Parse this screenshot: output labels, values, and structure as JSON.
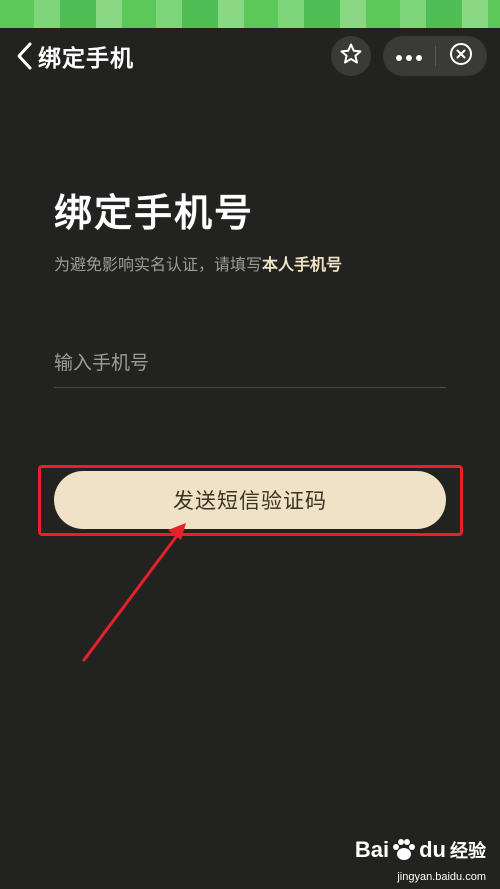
{
  "nav": {
    "title": "绑定手机"
  },
  "main": {
    "heading": "绑定手机号",
    "subtitle_prefix": "为避免影响实名认证，请填写",
    "subtitle_emphasis": "本人手机号",
    "phone_input": {
      "value": "",
      "placeholder": "输入手机号"
    },
    "send_button_label": "发送短信验证码"
  },
  "annotation": {
    "highlight_color": "#e8202a"
  },
  "watermark": {
    "brand_bai": "Bai",
    "brand_du": "du",
    "product": "经验",
    "url": "jingyan.baidu.com"
  },
  "colors": {
    "background": "#222220",
    "button_bg": "#efe2c6",
    "emphasis_text": "#efe4c6",
    "status_green": "#5cc85a"
  },
  "icons": {
    "back": "chevron-left-icon",
    "star": "star-icon",
    "more": "more-dots-icon",
    "close": "close-circle-icon"
  }
}
